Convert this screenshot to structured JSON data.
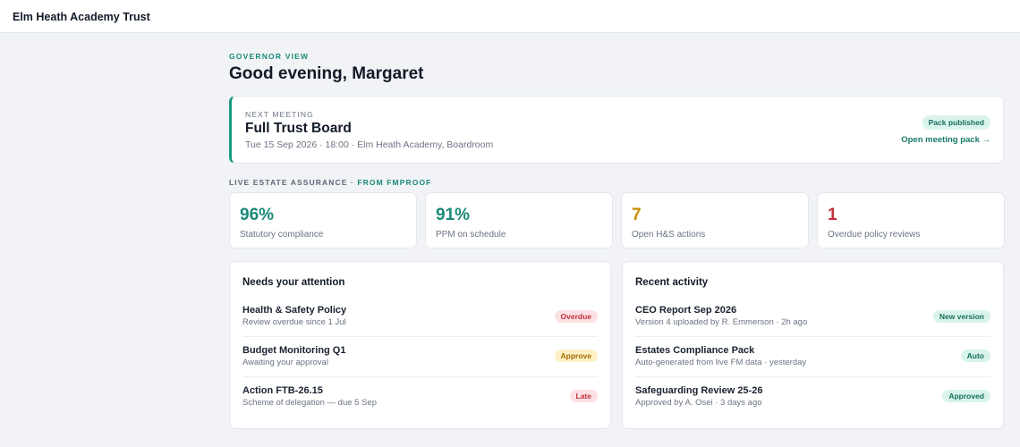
{
  "app": {
    "title": "Elm Heath Academy Trust"
  },
  "header": {
    "eyebrow": "GOVERNOR VIEW",
    "greeting": "Good evening, Margaret"
  },
  "meeting": {
    "label": "NEXT MEETING",
    "title": "Full Trust Board",
    "details": "Tue 15 Sep 2026 · 18:00 · Elm Heath Academy, Boardroom",
    "badge": "Pack published",
    "link": "Open meeting pack →"
  },
  "assurance": {
    "label": "LIVE ESTATE ASSURANCE ·",
    "source": "FROM FMPROOF",
    "stats": [
      {
        "value": "96%",
        "label": "Statutory compliance",
        "color": "#1b8a77"
      },
      {
        "value": "91%",
        "label": "PPM on schedule",
        "color": "#1b8a77"
      },
      {
        "value": "7",
        "label": "Open H&S actions",
        "color": "#c98a00"
      },
      {
        "value": "1",
        "label": "Overdue policy reviews",
        "color": "#c2303b"
      }
    ]
  },
  "attention": {
    "title": "Needs your attention",
    "items": [
      {
        "title": "Health & Safety Policy",
        "sub": "Review overdue since 1 Jul",
        "badge": "Overdue",
        "badge_color": "#c2303b"
      },
      {
        "title": "Budget Monitoring Q1",
        "sub": "Awaiting your approval",
        "badge": "Approve",
        "badge_color": "#a06b00"
      },
      {
        "title": "Action FTB-26.15",
        "sub": "Scheme of delegation — due 5 Sep",
        "badge": "Late",
        "badge_color": "#c2303b"
      }
    ]
  },
  "activity": {
    "title": "Recent activity",
    "items": [
      {
        "title": "CEO Report Sep 2026",
        "sub": "Version 4 uploaded by R. Emmerson · 2h ago",
        "badge": "New version",
        "badge_color": "#176f5f"
      },
      {
        "title": "Estates Compliance Pack",
        "sub": "Auto-generated from live FM data · yesterday",
        "badge": "Auto",
        "badge_color": "#176f5f"
      },
      {
        "title": "Safeguarding Review 25-26",
        "sub": "Approved by A. Osei · 3 days ago",
        "badge": "Approved",
        "badge_color": "#176f5f"
      }
    ]
  }
}
